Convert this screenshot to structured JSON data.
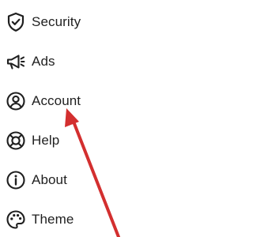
{
  "menu": {
    "items": [
      {
        "label": "Security",
        "icon": "shield-icon"
      },
      {
        "label": "Ads",
        "icon": "megaphone-icon"
      },
      {
        "label": "Account",
        "icon": "account-icon"
      },
      {
        "label": "Help",
        "icon": "lifebuoy-icon"
      },
      {
        "label": "About",
        "icon": "info-icon"
      },
      {
        "label": "Theme",
        "icon": "palette-icon"
      }
    ]
  },
  "annotation": {
    "arrow_color": "#d32f2f",
    "points_to": "Account"
  },
  "colors": {
    "text": "#1f1f1f",
    "icon": "#1f1f1f",
    "background": "#ffffff"
  }
}
